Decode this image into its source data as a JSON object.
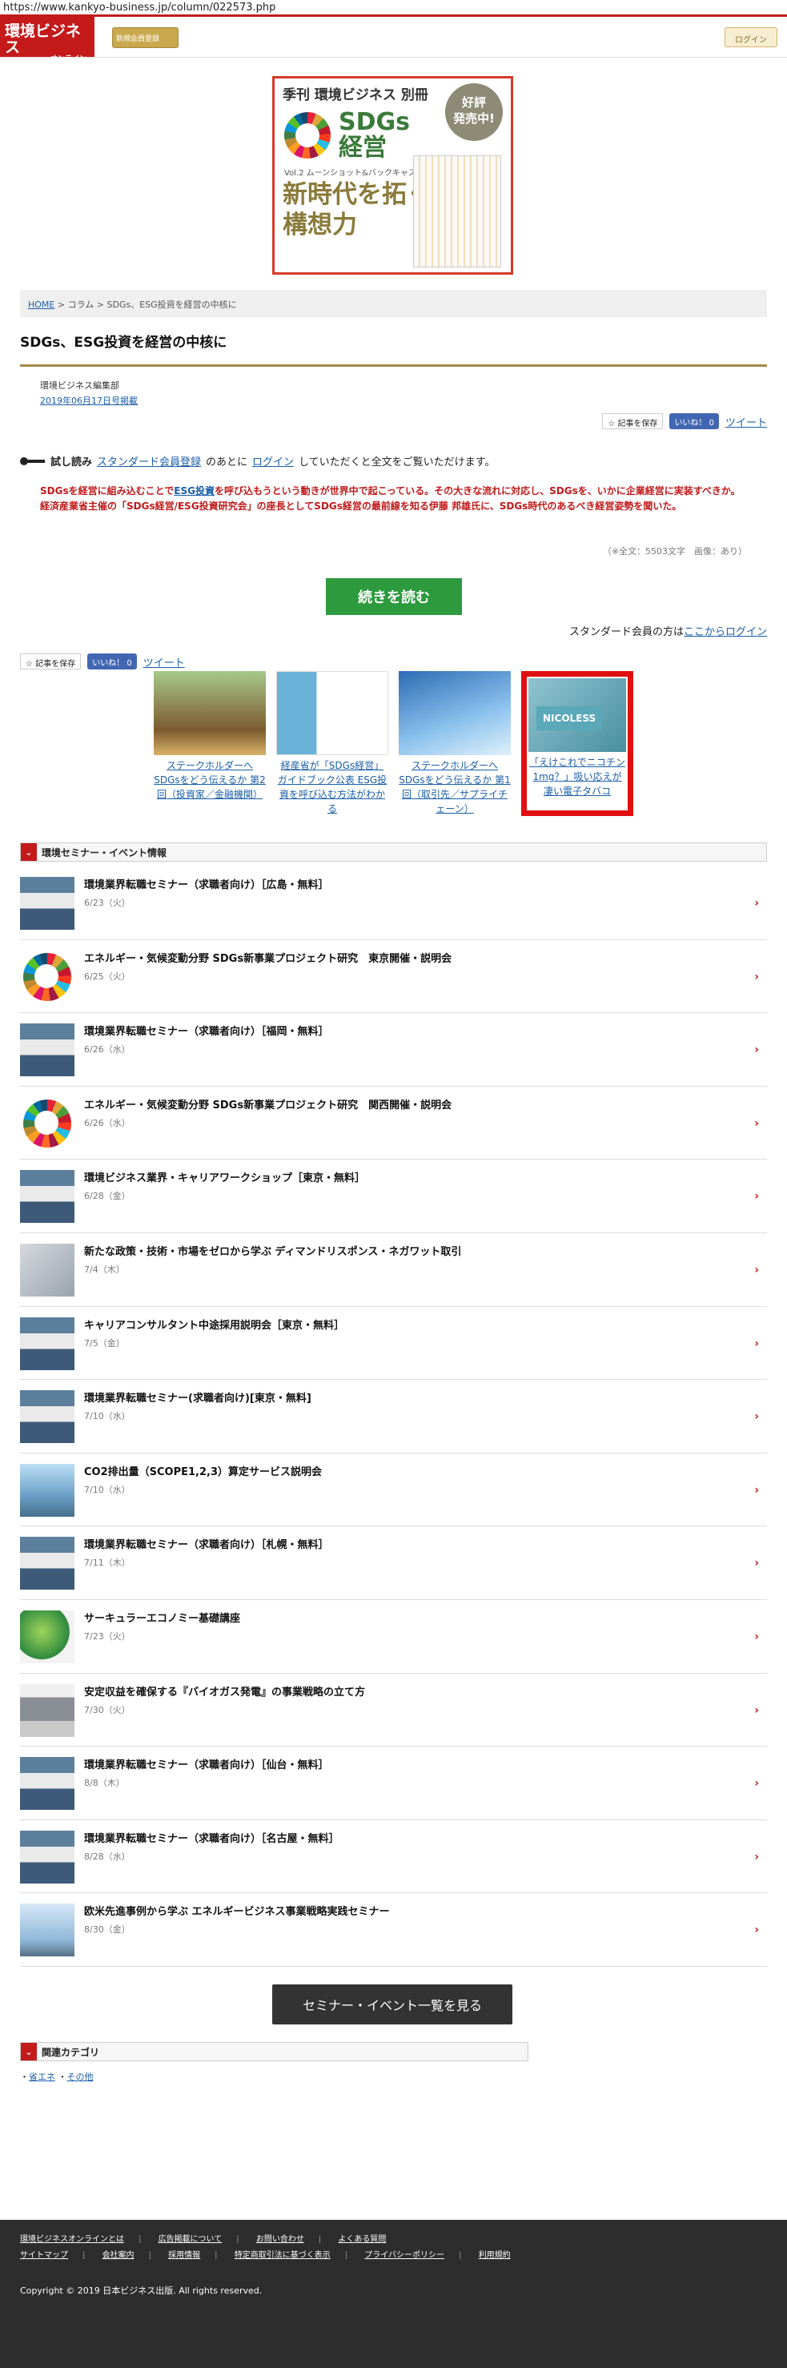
{
  "url": "https://www.kankyo-business.jp/column/022573.php",
  "header": {
    "logo_main": "環境ビジネス",
    "logo_sub": "オンライン",
    "register_label": "新規会員登録",
    "login_label": "ログイン"
  },
  "banner": {
    "top": "季刊 環境ビジネス 別冊",
    "sdg_title": "SDGs\n経営",
    "badge": "好評\n発売中!",
    "vol": "Vol.2 ムーンショット&バックキャスティング",
    "big": "新時代を拓く\n構想力"
  },
  "breadcrumb": {
    "home": "HOME",
    "column": "コラム",
    "current": "SDGs、ESG投資を経営の中核に"
  },
  "article": {
    "title": "SDGs、ESG投資を経営の中核に",
    "author": "環境ビジネス編集部",
    "pubdate": "2019年06月17日号掲載",
    "save_label": "記事を保存",
    "like_label": "いいね！ 0",
    "tweet_label": "ツイート",
    "trial_label": "試し読み",
    "trial_link1": "スタンダード会員登録",
    "trial_mid": "のあとに",
    "trial_link2": "ログイン",
    "trial_end": "していただくと全文をご覧いただけます。",
    "lead_a": "SDGsを経営に組み込むことで",
    "lead_link": "ESG投資",
    "lead_b": "を呼び込もうという動きが世界中で起こっている。その大きな流れに対応し、SDGsを、いかに企業経営に実装すべきか。経済産業省主催の「SDGs経営/ESG投資研究会」の座長としてSDGs経営の最前線を知る伊藤 邦雄氏に、SDGs時代のあるべき経営姿勢を聞いた。",
    "chars": "（※全文：5503文字　画像：あり）",
    "read_more": "続きを読む",
    "member_prefix": "スタンダード会員の方は",
    "member_link": "ここからログイン"
  },
  "related": [
    {
      "title": "ステークホルダーへSDGsをどう伝えるか 第2回（投資家／金融機関）"
    },
    {
      "title": "経産省が「SDGs経営」ガイドブック公表 ESG投資を呼び込む方法がわかる"
    },
    {
      "title": "ステークホルダーへSDGsをどう伝えるか 第1回（取引先／サプライチェーン）"
    },
    {
      "title": "「えけこれでニコチン1mg？」吸い応えが凄い電子タバコ",
      "thumb_text": "NICOLESS"
    }
  ],
  "events_header": "環境セミナー・イベント情報",
  "events": [
    {
      "title": "環境業界転職セミナー（求職者向け）［広島・無料］",
      "date": "6/23（火）"
    },
    {
      "title": "エネルギー・気候変動分野 SDGs新事業プロジェクト研究　東京開催・説明会",
      "date": "6/25（火）"
    },
    {
      "title": "環境業界転職セミナー（求職者向け）［福岡・無料］",
      "date": "6/26（水）"
    },
    {
      "title": "エネルギー・気候変動分野 SDGs新事業プロジェクト研究　関西開催・説明会",
      "date": "6/26（水）"
    },
    {
      "title": "環境ビジネス業界・キャリアワークショップ［東京・無料］",
      "date": "6/28（金）"
    },
    {
      "title": "新たな政策・技術・市場をゼロから学ぶ ディマンドリスポンス・ネガワット取引",
      "date": "7/4（木）"
    },
    {
      "title": "キャリアコンサルタント中途採用説明会［東京・無料］",
      "date": "7/5（金）"
    },
    {
      "title": "環境業界転職セミナー(求職者向け)[東京・無料]",
      "date": "7/10（水）"
    },
    {
      "title": "CO2排出量（SCOPE1,2,3）算定サービス説明会",
      "date": "7/10（水）"
    },
    {
      "title": "環境業界転職セミナー（求職者向け）［札幌・無料］",
      "date": "7/11（木）"
    },
    {
      "title": "サーキュラーエコノミー基礎講座",
      "date": "7/23（火）"
    },
    {
      "title": "安定収益を確保する『バイオガス発電』の事業戦略の立て方",
      "date": "7/30（火）"
    },
    {
      "title": "環境業界転職セミナー（求職者向け）［仙台・無料］",
      "date": "8/8（木）"
    },
    {
      "title": "環境業界転職セミナー（求職者向け）［名古屋・無料］",
      "date": "8/28（水）"
    },
    {
      "title": "欧米先進事例から学ぶ エネルギービジネス事業戦略実践セミナー",
      "date": "8/30（金）"
    }
  ],
  "events_button": "セミナー・イベント一覧を見る",
  "category_header": "関連カテゴリ",
  "categories": [
    "省エネ",
    "その他"
  ],
  "footer": {
    "links_row1": [
      "環境ビジネスオンラインとは",
      "広告掲載について",
      "お問い合わせ",
      "よくある質問"
    ],
    "links_row2": [
      "サイトマップ",
      "会社案内",
      "採用情報",
      "特定商取引法に基づく表示",
      "プライバシーポリシー",
      "利用規約"
    ],
    "copyright": "Copyright © 2019 日本ビジネス出版. All rights reserved."
  }
}
